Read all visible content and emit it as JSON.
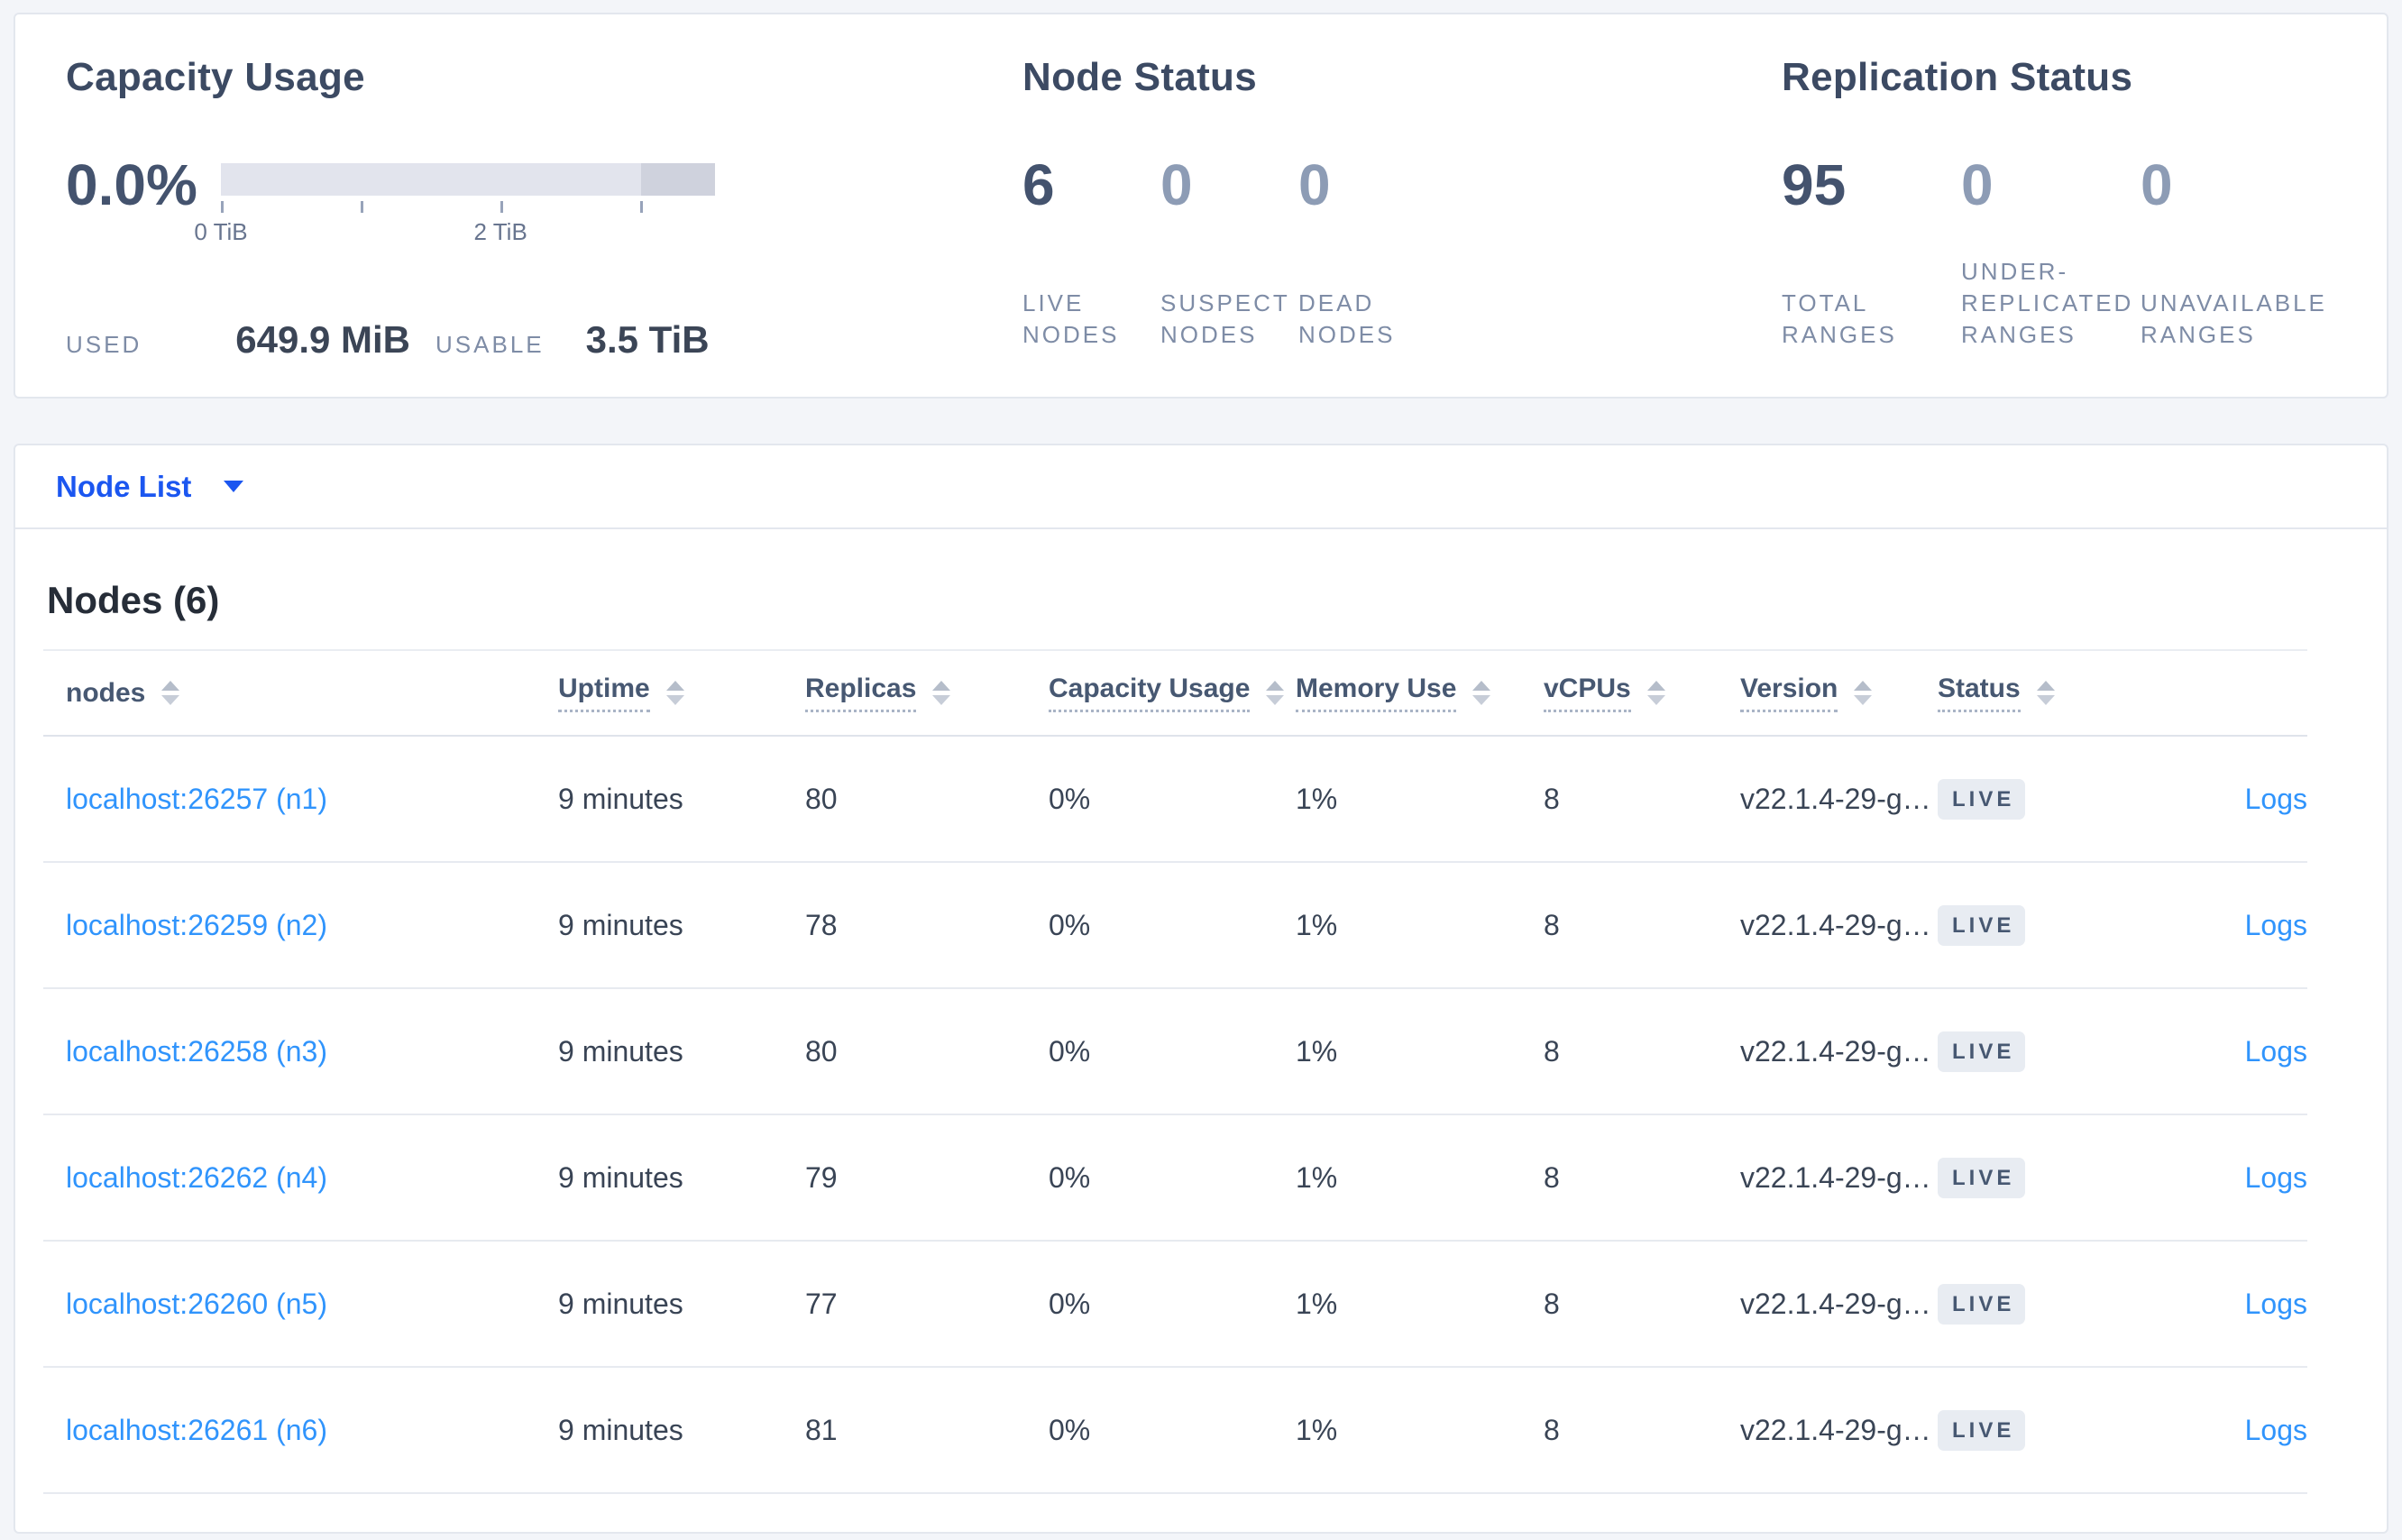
{
  "colors": {
    "primary": "#1b56f0",
    "link": "#3094fc",
    "badge_bg": "#e8ecf2",
    "badge_text": "#475872",
    "bar_track": "#e2e4ed",
    "bar_segment": "#cfd2dd"
  },
  "summary": {
    "capacity": {
      "title": "Capacity Usage",
      "percent": "0.0%",
      "axis_ticks": [
        "0 TiB",
        "2 TiB"
      ],
      "used_label": "USED",
      "used_value": "649.9 MiB",
      "usable_label": "USABLE",
      "usable_value": "3.5 TiB"
    },
    "node_status": {
      "title": "Node Status",
      "stats": [
        {
          "id": "live-nodes",
          "value": "6",
          "label_lines": [
            "LIVE",
            "NODES"
          ],
          "emphasis": true
        },
        {
          "id": "suspect-nodes",
          "value": "0",
          "label_lines": [
            "SUSPECT",
            "NODES"
          ],
          "emphasis": false
        },
        {
          "id": "dead-nodes",
          "value": "0",
          "label_lines": [
            "DEAD",
            "NODES"
          ],
          "emphasis": false
        }
      ]
    },
    "replication": {
      "title": "Replication Status",
      "stats": [
        {
          "id": "total-ranges",
          "value": "95",
          "label_lines": [
            "TOTAL",
            "RANGES"
          ],
          "emphasis": true
        },
        {
          "id": "under-replicated-ranges",
          "value": "0",
          "label_lines": [
            "UNDER-",
            "REPLICATED",
            "RANGES"
          ],
          "emphasis": false
        },
        {
          "id": "unavailable-ranges",
          "value": "0",
          "label_lines": [
            "UNAVAILABLE",
            "RANGES"
          ],
          "emphasis": false
        }
      ]
    }
  },
  "view_selector": {
    "label": "Node List"
  },
  "table": {
    "title": "Nodes (6)",
    "columns": [
      {
        "key": "node",
        "label": "nodes",
        "sortable": true,
        "underline": false
      },
      {
        "key": "uptime",
        "label": "Uptime",
        "sortable": true,
        "underline": true
      },
      {
        "key": "replicas",
        "label": "Replicas",
        "sortable": true,
        "underline": true
      },
      {
        "key": "capacity",
        "label": "Capacity Usage",
        "sortable": true,
        "underline": true
      },
      {
        "key": "memory",
        "label": "Memory Use",
        "sortable": true,
        "underline": true
      },
      {
        "key": "vcpus",
        "label": "vCPUs",
        "sortable": true,
        "underline": true
      },
      {
        "key": "version",
        "label": "Version",
        "sortable": true,
        "underline": true
      },
      {
        "key": "status",
        "label": "Status",
        "sortable": true,
        "underline": true
      },
      {
        "key": "logs",
        "label": "",
        "sortable": false,
        "underline": false
      }
    ],
    "rows": [
      {
        "node": "localhost:26257 (n1)",
        "uptime": "9 minutes",
        "replicas": "80",
        "capacity": "0%",
        "memory": "1%",
        "vcpus": "8",
        "version": "v22.1.4-29-g…",
        "status": "LIVE",
        "logs": "Logs"
      },
      {
        "node": "localhost:26259 (n2)",
        "uptime": "9 minutes",
        "replicas": "78",
        "capacity": "0%",
        "memory": "1%",
        "vcpus": "8",
        "version": "v22.1.4-29-g…",
        "status": "LIVE",
        "logs": "Logs"
      },
      {
        "node": "localhost:26258 (n3)",
        "uptime": "9 minutes",
        "replicas": "80",
        "capacity": "0%",
        "memory": "1%",
        "vcpus": "8",
        "version": "v22.1.4-29-g…",
        "status": "LIVE",
        "logs": "Logs"
      },
      {
        "node": "localhost:26262 (n4)",
        "uptime": "9 minutes",
        "replicas": "79",
        "capacity": "0%",
        "memory": "1%",
        "vcpus": "8",
        "version": "v22.1.4-29-g…",
        "status": "LIVE",
        "logs": "Logs"
      },
      {
        "node": "localhost:26260 (n5)",
        "uptime": "9 minutes",
        "replicas": "77",
        "capacity": "0%",
        "memory": "1%",
        "vcpus": "8",
        "version": "v22.1.4-29-g…",
        "status": "LIVE",
        "logs": "Logs"
      },
      {
        "node": "localhost:26261 (n6)",
        "uptime": "9 minutes",
        "replicas": "81",
        "capacity": "0%",
        "memory": "1%",
        "vcpus": "8",
        "version": "v22.1.4-29-g…",
        "status": "LIVE",
        "logs": "Logs"
      }
    ]
  }
}
